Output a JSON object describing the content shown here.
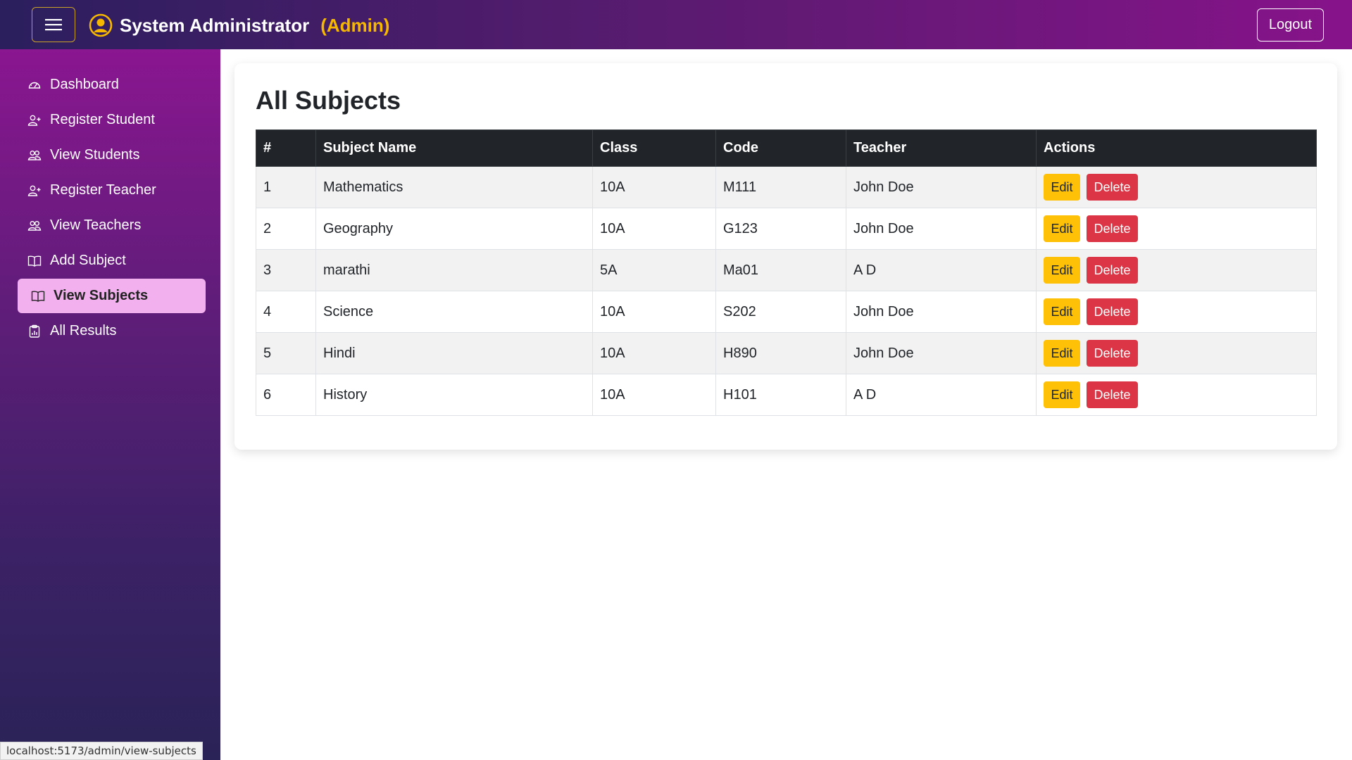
{
  "header": {
    "menu_icon": "hamburger-icon",
    "user_icon": "user-circle-icon",
    "name": "System Administrator",
    "role": "(Admin)",
    "logout_label": "Logout"
  },
  "sidebar": {
    "items": [
      {
        "label": "Dashboard",
        "icon": "speedometer-icon",
        "active": false
      },
      {
        "label": "Register Student",
        "icon": "person-plus-icon",
        "active": false
      },
      {
        "label": "View Students",
        "icon": "people-icon",
        "active": false
      },
      {
        "label": "Register Teacher",
        "icon": "person-plus-icon",
        "active": false
      },
      {
        "label": "View Teachers",
        "icon": "people-icon",
        "active": false
      },
      {
        "label": "Add Subject",
        "icon": "book-icon",
        "active": false
      },
      {
        "label": "View Subjects",
        "icon": "book-icon",
        "active": true
      },
      {
        "label": "All Results",
        "icon": "clipboard-data-icon",
        "active": false
      }
    ]
  },
  "main": {
    "title": "All Subjects",
    "table": {
      "headers": [
        "#",
        "Subject Name",
        "Class",
        "Code",
        "Teacher",
        "Actions"
      ],
      "rows": [
        {
          "num": "1",
          "name": "Mathematics",
          "class": "10A",
          "code": "M111",
          "teacher": "John Doe"
        },
        {
          "num": "2",
          "name": "Geography",
          "class": "10A",
          "code": "G123",
          "teacher": "John Doe"
        },
        {
          "num": "3",
          "name": "marathi",
          "class": "5A",
          "code": "Ma01",
          "teacher": "A D"
        },
        {
          "num": "4",
          "name": "Science",
          "class": "10A",
          "code": "S202",
          "teacher": "John Doe"
        },
        {
          "num": "5",
          "name": "Hindi",
          "class": "10A",
          "code": "H890",
          "teacher": "John Doe"
        },
        {
          "num": "6",
          "name": "History",
          "class": "10A",
          "code": "H101",
          "teacher": "A D"
        }
      ],
      "edit_label": "Edit",
      "delete_label": "Delete"
    }
  },
  "status_bar": {
    "url": "localhost:5173/admin/view-subjects"
  },
  "colors": {
    "accent_gold": "#f5b700",
    "active_nav": "#f3b0ee",
    "edit_button": "#ffc107",
    "delete_button": "#dc3545",
    "table_header": "#212529"
  }
}
